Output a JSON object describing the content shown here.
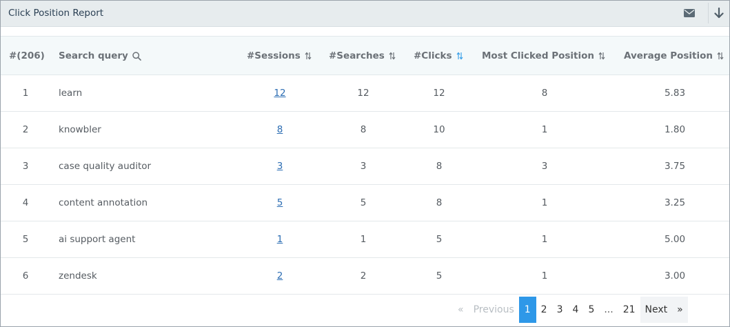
{
  "report": {
    "title": "Click Position Report"
  },
  "icons": {
    "email": "envelope-icon",
    "download": "arrow-down-icon",
    "search": "magnifier-icon",
    "sort": "sort-arrows-icon"
  },
  "colors": {
    "accent": "#2e98e8",
    "link": "#2c6db3",
    "active_sort": "#3aa0e8"
  },
  "table": {
    "headers": {
      "index": "#(206)",
      "query": "Search query",
      "sessions": "#Sessions",
      "searches": "#Searches",
      "clicks": "#Clicks",
      "most_clicked": "Most Clicked Position",
      "avg_position": "Average Position"
    },
    "rows": [
      {
        "index": "1",
        "query": "learn",
        "sessions": "12",
        "searches": "12",
        "clicks": "12",
        "most_clicked": "8",
        "avg_position": "5.83"
      },
      {
        "index": "2",
        "query": "knowbler",
        "sessions": "8",
        "searches": "8",
        "clicks": "10",
        "most_clicked": "1",
        "avg_position": "1.80"
      },
      {
        "index": "3",
        "query": "case quality auditor",
        "sessions": "3",
        "searches": "3",
        "clicks": "8",
        "most_clicked": "3",
        "avg_position": "3.75"
      },
      {
        "index": "4",
        "query": "content annotation",
        "sessions": "5",
        "searches": "5",
        "clicks": "8",
        "most_clicked": "1",
        "avg_position": "3.25"
      },
      {
        "index": "5",
        "query": "ai support agent",
        "sessions": "1",
        "searches": "1",
        "clicks": "5",
        "most_clicked": "1",
        "avg_position": "5.00"
      },
      {
        "index": "6",
        "query": "zendesk",
        "sessions": "2",
        "searches": "2",
        "clicks": "5",
        "most_clicked": "1",
        "avg_position": "3.00"
      }
    ]
  },
  "pagination": {
    "first": "«",
    "previous": "Previous",
    "pages": [
      "1",
      "2",
      "3",
      "4",
      "5"
    ],
    "ellipsis": "...",
    "last_page": "21",
    "next": "Next",
    "last": "»",
    "current": "1"
  }
}
